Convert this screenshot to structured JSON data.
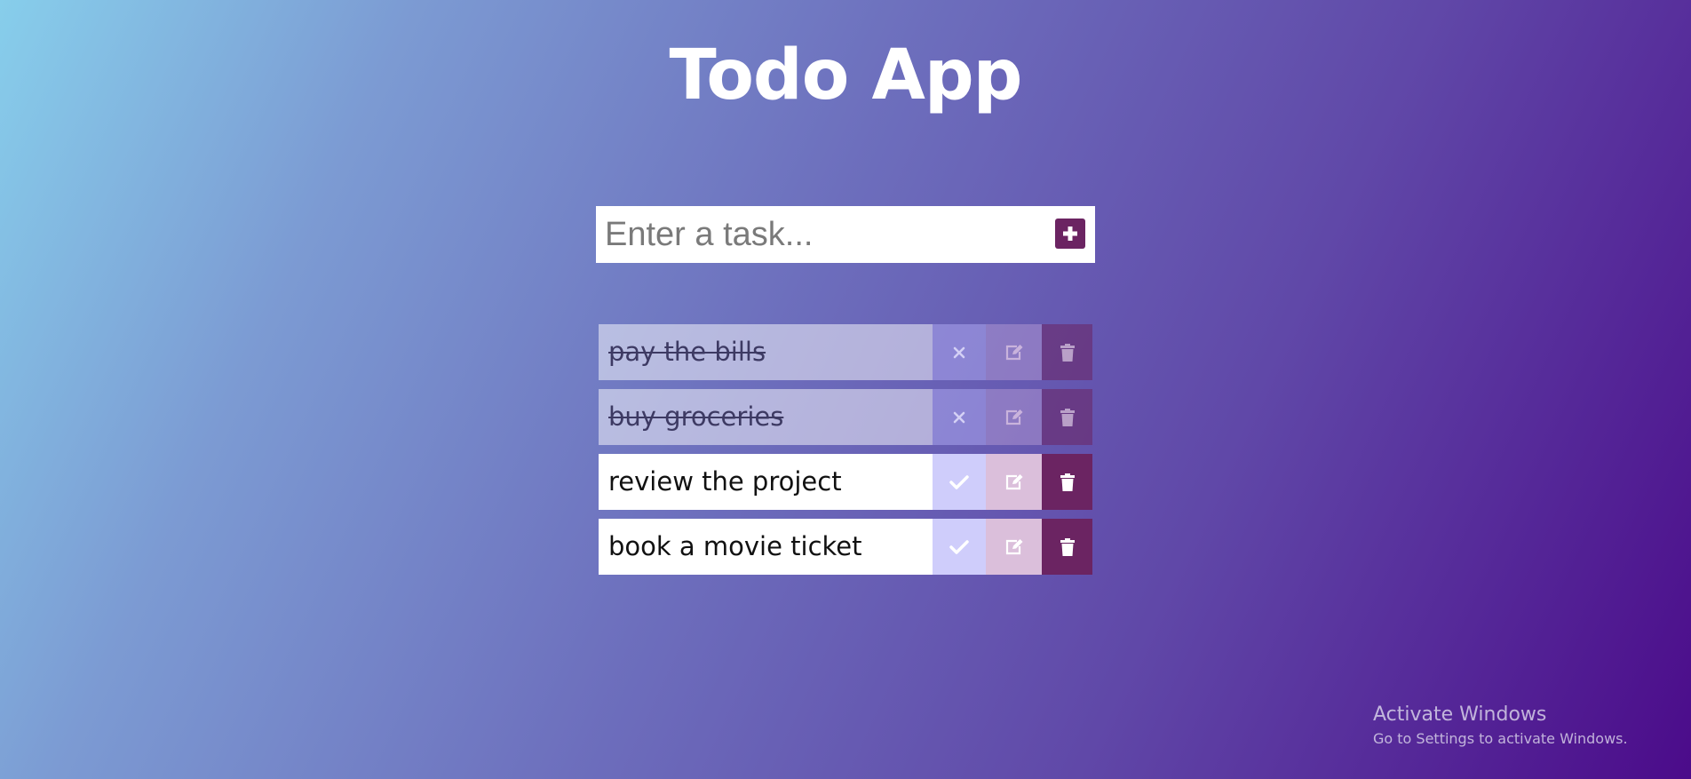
{
  "app": {
    "title": "Todo App"
  },
  "input": {
    "placeholder": "Enter a task...",
    "value": ""
  },
  "colors": {
    "accent": "#6b2462",
    "check_button": "#cfcdfb",
    "edit_button": "#dbbfdb"
  },
  "todos": [
    {
      "text": "pay the bills",
      "completed": true,
      "toggle_icon": "x-icon"
    },
    {
      "text": "buy groceries",
      "completed": true,
      "toggle_icon": "x-icon"
    },
    {
      "text": "review the project",
      "completed": false,
      "toggle_icon": "check-icon"
    },
    {
      "text": "book a movie ticket",
      "completed": false,
      "toggle_icon": "check-icon"
    }
  ],
  "watermark": {
    "title": "Activate Windows",
    "subtitle": "Go to Settings to activate Windows."
  }
}
